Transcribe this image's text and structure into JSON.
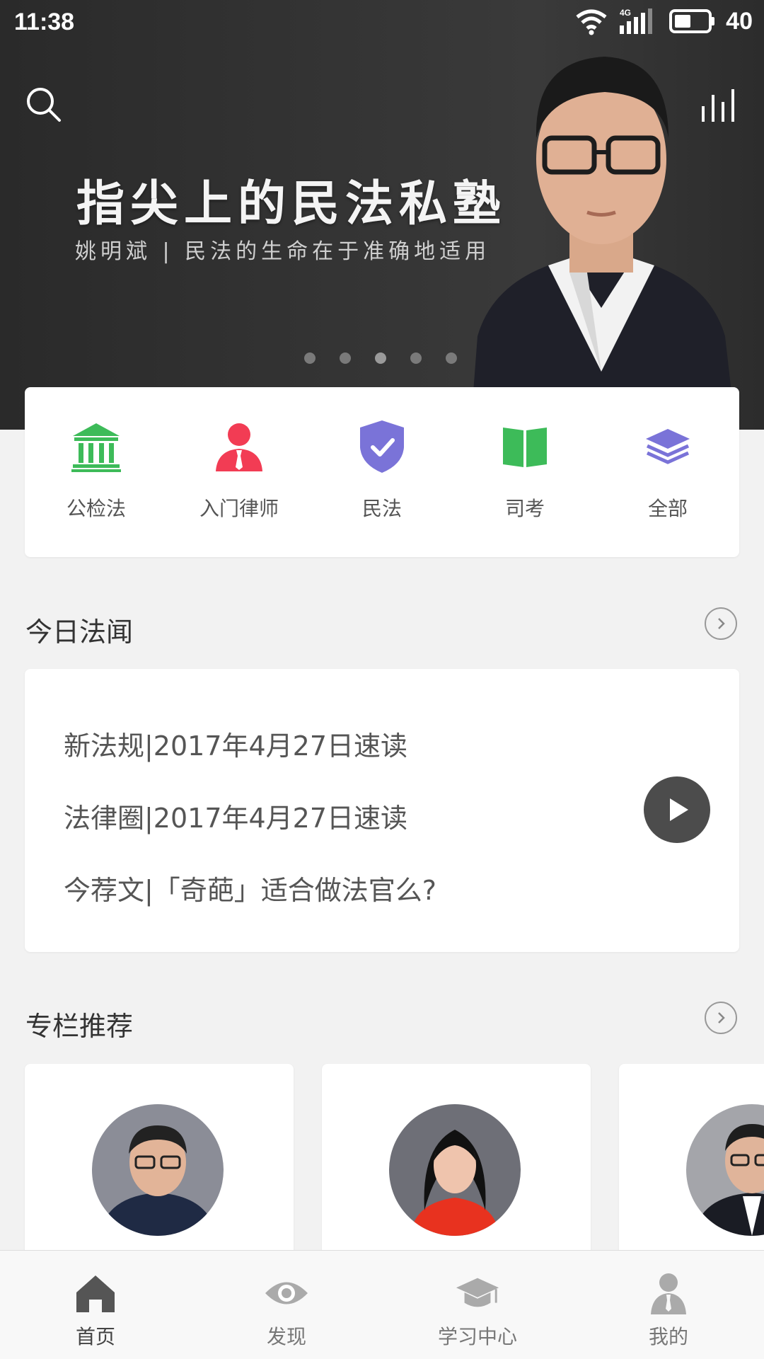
{
  "status_bar": {
    "time": "11:38",
    "network": "4G",
    "battery": "40",
    "icons": [
      "wifi-icon",
      "signal-icon",
      "battery-icon"
    ]
  },
  "banner": {
    "title": "指尖上的民法私塾",
    "subtitle": "姚明斌 | 民法的生命在于准确地适用",
    "dots_count": 5,
    "active_dot": 2
  },
  "categories": [
    {
      "label": "公检法",
      "icon": "court-building-icon",
      "color": "#3dbb59"
    },
    {
      "label": "入门律师",
      "icon": "lawyer-person-icon",
      "color": "#f23c54"
    },
    {
      "label": "民法",
      "icon": "shield-check-icon",
      "color": "#7a73d8"
    },
    {
      "label": "司考",
      "icon": "open-book-icon",
      "color": "#3dbb59"
    },
    {
      "label": "全部",
      "icon": "layers-icon",
      "color": "#7a73d8"
    }
  ],
  "news": {
    "title": "今日法闻",
    "items": [
      "新法规|2017年4月27日速读",
      "法律圈|2017年4月27日速读",
      "今荐文|「奇葩」适合做法官么?"
    ]
  },
  "columns": {
    "title": "专栏推荐"
  },
  "bottom_nav": [
    {
      "label": "首页",
      "icon": "home-icon",
      "active": true
    },
    {
      "label": "发现",
      "icon": "eye-icon",
      "active": false
    },
    {
      "label": "学习中心",
      "icon": "graduation-cap-icon",
      "active": false
    },
    {
      "label": "我的",
      "icon": "user-icon",
      "active": false
    }
  ],
  "colors": {
    "green": "#3dbb59",
    "red": "#f23c54",
    "purple": "#7a73d8",
    "dark": "#333333"
  }
}
